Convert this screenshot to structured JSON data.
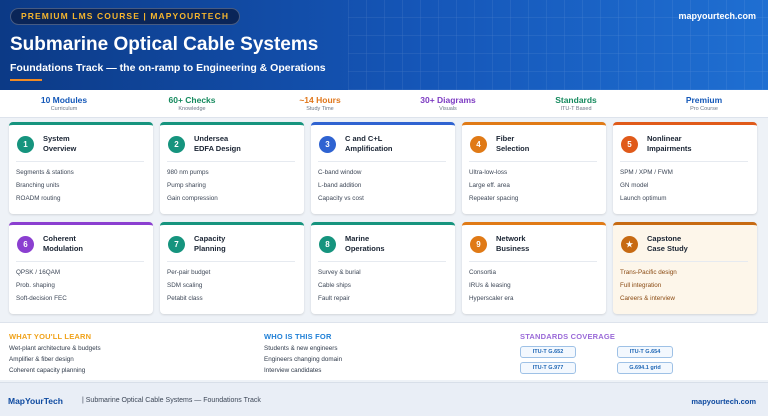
{
  "header": {
    "badge": "PREMIUM LMS COURSE | MAPYOURTECH",
    "site": "mapyourtech.com",
    "title": "Submarine Optical Cable Systems",
    "subtitle": "Foundations Track — the on-ramp to Engineering & Operations"
  },
  "stats": [
    {
      "value": "10 Modules",
      "label": "Curriculum",
      "color": "#1458b8"
    },
    {
      "value": "60+ Checks",
      "label": "Knowledge",
      "color": "#168a5e"
    },
    {
      "value": "~14 Hours",
      "label": "Study Time",
      "color": "#e0761a"
    },
    {
      "value": "30+ Diagrams",
      "label": "Visuals",
      "color": "#7d3bc2"
    },
    {
      "value": "Standards",
      "label": "ITU-T Based",
      "color": "#168a5e"
    },
    {
      "value": "Premium",
      "label": "Pro Course",
      "color": "#1458b8"
    }
  ],
  "modules": [
    {
      "num": "1",
      "t1": "System",
      "t2": "Overview",
      "color": "#16947e",
      "items": [
        "Segments & stations",
        "Branching units",
        "ROADM routing"
      ]
    },
    {
      "num": "2",
      "t1": "Undersea",
      "t2": "EDFA Design",
      "color": "#16947e",
      "items": [
        "980 nm pumps",
        "Pump sharing",
        "Gain compression"
      ]
    },
    {
      "num": "3",
      "t1": "C and C+L",
      "t2": "Amplification",
      "color": "#2f63d1",
      "items": [
        "C-band window",
        "L-band addition",
        "Capacity vs cost"
      ]
    },
    {
      "num": "4",
      "t1": "Fiber",
      "t2": "Selection",
      "color": "#e07a16",
      "items": [
        "Ultra-low-loss",
        "Large eff. area",
        "Repeater spacing"
      ]
    },
    {
      "num": "5",
      "t1": "Nonlinear",
      "t2": "Impairments",
      "color": "#e05a1a",
      "items": [
        "SPM / XPM / FWM",
        "GN model",
        "Launch optimum"
      ]
    },
    {
      "num": "6",
      "t1": "Coherent",
      "t2": "Modulation",
      "color": "#8b3fd0",
      "items": [
        "QPSK / 16QAM",
        "Prob. shaping",
        "Soft-decision FEC"
      ]
    },
    {
      "num": "7",
      "t1": "Capacity",
      "t2": "Planning",
      "color": "#16947e",
      "items": [
        "Per-pair budget",
        "SDM scaling",
        "Petabit class"
      ]
    },
    {
      "num": "8",
      "t1": "Marine",
      "t2": "Operations",
      "color": "#16947e",
      "items": [
        "Survey & burial",
        "Cable ships",
        "Fault repair"
      ]
    },
    {
      "num": "9",
      "t1": "Network",
      "t2": "Business",
      "color": "#e07a16",
      "items": [
        "Consortia",
        "IRUs & leasing",
        "Hyperscaler era"
      ]
    },
    {
      "num": "★",
      "t1": "Capstone",
      "t2": "Case Study",
      "color": "#c76a12",
      "items": [
        "Trans-Pacific design",
        "Full integration",
        "Careers & interview"
      ]
    }
  ],
  "learn": {
    "heading": "WHAT YOU'LL LEARN",
    "color": "#f0a21a",
    "items": [
      "Wet-plant architecture & budgets",
      "Amplifier & fiber design",
      "Coherent capacity planning"
    ]
  },
  "audience": {
    "heading": "WHO IS THIS FOR",
    "color": "#1e7fd6",
    "items": [
      "Students & new engineers",
      "Engineers changing domain",
      "Interview candidates"
    ]
  },
  "standards": {
    "heading": "STANDARDS COVERAGE",
    "color": "#9a6ad8",
    "items": [
      "ITU-T G.652",
      "ITU-T G.654",
      "ITU-T G.977",
      "G.694.1 grid"
    ]
  },
  "footer": {
    "brand": "MapYourTech",
    "text": "| Submarine Optical Cable Systems — Foundations Track",
    "site": "mapyourtech.com"
  }
}
